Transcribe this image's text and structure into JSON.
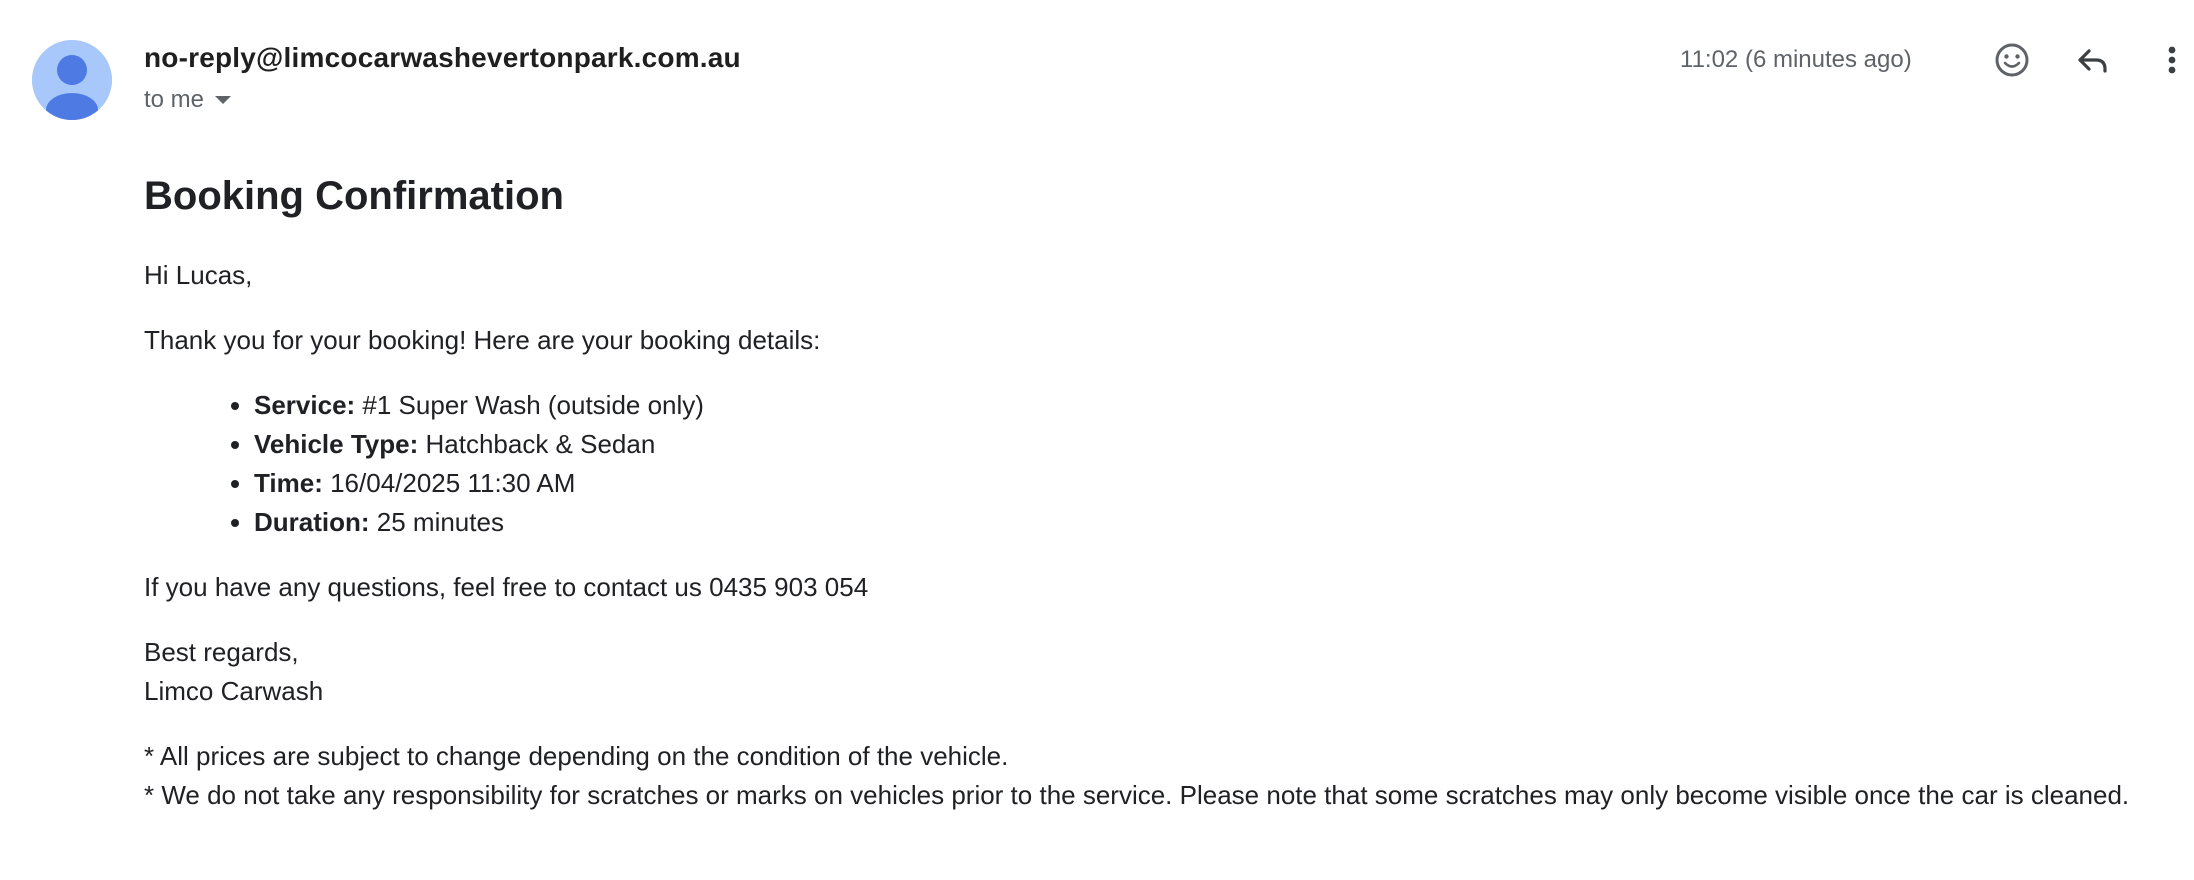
{
  "email": {
    "sender": "no-reply@limcocarwashevertonpark.com.au",
    "recipient_label": "to me",
    "timestamp": "11:02 (6 minutes ago)",
    "icons": {
      "avatar": "person-avatar-icon",
      "recipients_toggle": "caret-down-icon",
      "emoji": "smiley-icon",
      "reply": "reply-arrow-icon",
      "more": "vertical-dots-icon"
    },
    "colors": {
      "avatar_bg": "#a8c7fa",
      "avatar_fg": "#4e7be3",
      "text": "#202124",
      "muted": "#5f6368"
    }
  },
  "message": {
    "heading": "Booking Confirmation",
    "greeting": "Hi Lucas,",
    "intro": "Thank you for your booking! Here are your booking details:",
    "details": [
      {
        "label": "Service:",
        "value": " #1 Super Wash (outside only)"
      },
      {
        "label": "Vehicle Type:",
        "value": " Hatchback & Sedan"
      },
      {
        "label": "Time:",
        "value": " 16/04/2025 11:30 AM"
      },
      {
        "label": "Duration:",
        "value": " 25 minutes"
      }
    ],
    "contact": "If you have any questions, feel free to contact us 0435 903 054",
    "signoff_line1": "Best regards,",
    "signoff_line2": "Limco Carwash",
    "note1": "* All prices are subject to change depending on the condition of the vehicle.",
    "note2": "* We do not take any responsibility for scratches or marks on vehicles prior to the service. Please note that some scratches may only become visible once the car is cleaned."
  }
}
